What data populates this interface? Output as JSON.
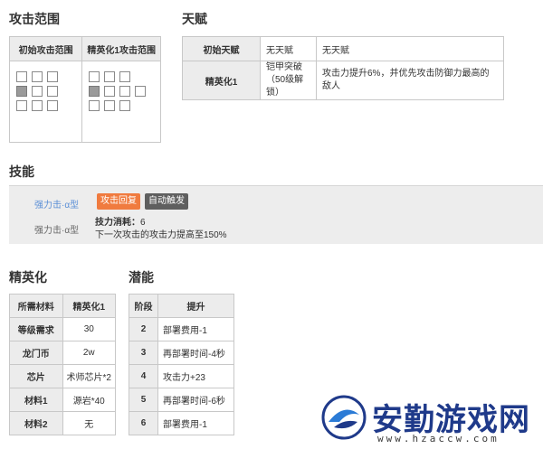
{
  "sections": {
    "range": "攻击范围",
    "talent": "天赋",
    "skill": "技能",
    "elite": "精英化",
    "potential": "潜能"
  },
  "range_table": {
    "headers": [
      "初始攻击范围",
      "精英化1攻击范围"
    ]
  },
  "talent_table": {
    "rows": [
      {
        "stage": "初始天赋",
        "name": "无天赋",
        "effect": "无天赋"
      },
      {
        "stage": "精英化1",
        "name": "铠甲突破（50级解锁）",
        "effect": "攻击力提升6%，并优先攻击防御力最高的敌人"
      }
    ]
  },
  "skill": {
    "name_1": "强力击·α型",
    "name_2": "强力击·α型",
    "tag_recovery": "攻击回复",
    "tag_trigger": "自动触发",
    "cost_label": "技力消耗：",
    "cost_value": "6",
    "description": "下一次攻击的攻击力提高至150%"
  },
  "elite_table": {
    "headers": [
      "所需材料",
      "精英化1"
    ],
    "rows": [
      {
        "label": "等级需求",
        "value": "30"
      },
      {
        "label": "龙门币",
        "value": "2w"
      },
      {
        "label": "芯片",
        "value": "术师芯片*2"
      },
      {
        "label": "材料1",
        "value": "源岩*40"
      },
      {
        "label": "材料2",
        "value": "无"
      }
    ]
  },
  "potential_table": {
    "headers": [
      "阶段",
      "提升"
    ],
    "rows": [
      {
        "stage": "2",
        "value": "部署费用-1"
      },
      {
        "stage": "3",
        "value": "再部署时间-4秒"
      },
      {
        "stage": "4",
        "value": "攻击力+23"
      },
      {
        "stage": "5",
        "value": "再部署时间-6秒"
      },
      {
        "stage": "6",
        "value": "部署费用-1"
      }
    ]
  },
  "watermark": {
    "brand": "安勤游戏网",
    "url": "www.hzaccw.com",
    "brand_color": "#1f3a8a"
  }
}
